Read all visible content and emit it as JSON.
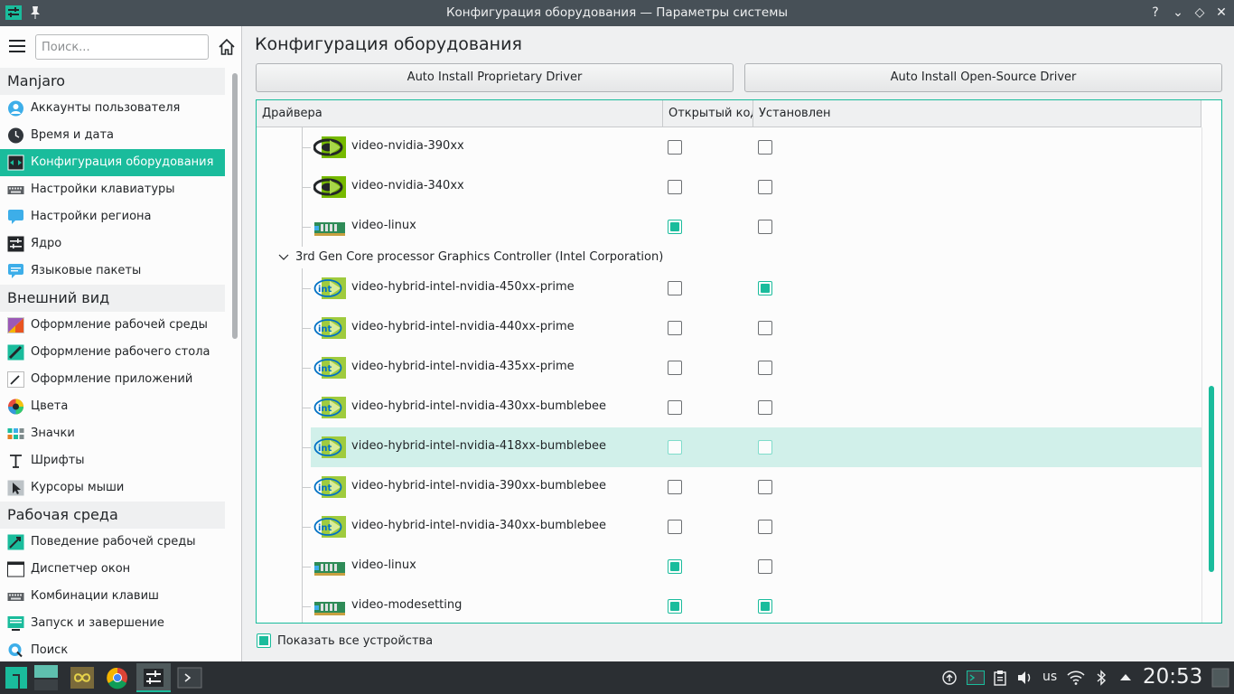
{
  "window": {
    "title": "Конфигурация оборудования — Параметры системы",
    "help_glyph": "?",
    "minimize_glyph": "⌄",
    "maximize_glyph": "◇",
    "close_glyph": "✕"
  },
  "sidebar": {
    "search_placeholder": "Поиск...",
    "categories": [
      {
        "label": "Manjaro",
        "items": [
          {
            "label": "Аккаунты пользователя",
            "icon": "user-icon"
          },
          {
            "label": "Время и дата",
            "icon": "clock-icon"
          },
          {
            "label": "Конфигурация оборудования",
            "icon": "hardware-icon",
            "selected": true
          },
          {
            "label": "Настройки клавиатуры",
            "icon": "keyboard-icon"
          },
          {
            "label": "Настройки региона",
            "icon": "region-icon"
          },
          {
            "label": "Ядро",
            "icon": "kernel-icon"
          },
          {
            "label": "Языковые пакеты",
            "icon": "language-icon"
          }
        ]
      },
      {
        "label": "Внешний вид",
        "items": [
          {
            "label": "Оформление рабочей среды",
            "icon": "workspace-theme-icon"
          },
          {
            "label": "Оформление рабочего стола",
            "icon": "desktop-theme-icon"
          },
          {
            "label": "Оформление приложений",
            "icon": "app-style-icon"
          },
          {
            "label": "Цвета",
            "icon": "colors-icon"
          },
          {
            "label": "Значки",
            "icon": "icons-icon"
          },
          {
            "label": "Шрифты",
            "icon": "fonts-icon"
          },
          {
            "label": "Курсоры мыши",
            "icon": "cursor-icon"
          }
        ]
      },
      {
        "label": "Рабочая среда",
        "items": [
          {
            "label": "Поведение рабочей среды",
            "icon": "workspace-behavior-icon"
          },
          {
            "label": "Диспетчер окон",
            "icon": "window-manager-icon"
          },
          {
            "label": "Комбинации клавиш",
            "icon": "shortcuts-icon"
          },
          {
            "label": "Запуск и завершение",
            "icon": "startup-icon"
          },
          {
            "label": "Поиск",
            "icon": "search-icon"
          }
        ]
      }
    ]
  },
  "main": {
    "title": "Конфигурация оборудования",
    "btn_proprietary": "Auto Install Proprietary Driver",
    "btn_opensource": "Auto Install Open-Source Driver",
    "columns": [
      "Драйвера",
      "Открытый код",
      "Установлен"
    ],
    "rows_top": [
      {
        "name": "video-nvidia-390xx",
        "icon": "nvidia-icon",
        "open": false,
        "installed": false
      },
      {
        "name": "video-nvidia-340xx",
        "icon": "nvidia-icon",
        "open": false,
        "installed": false
      },
      {
        "name": "video-linux",
        "icon": "video-card-icon",
        "open": true,
        "installed": false
      }
    ],
    "group_label": "3rd Gen Core processor Graphics Controller (Intel Corporation)",
    "rows_group": [
      {
        "name": "video-hybrid-intel-nvidia-450xx-prime",
        "icon": "intel-icon",
        "open": false,
        "installed": true
      },
      {
        "name": "video-hybrid-intel-nvidia-440xx-prime",
        "icon": "intel-icon",
        "open": false,
        "installed": false
      },
      {
        "name": "video-hybrid-intel-nvidia-435xx-prime",
        "icon": "intel-icon",
        "open": false,
        "installed": false
      },
      {
        "name": "video-hybrid-intel-nvidia-430xx-bumblebee",
        "icon": "intel-icon",
        "open": false,
        "installed": false
      },
      {
        "name": "video-hybrid-intel-nvidia-418xx-bumblebee",
        "icon": "intel-icon",
        "open": false,
        "installed": false,
        "highlight": true
      },
      {
        "name": "video-hybrid-intel-nvidia-390xx-bumblebee",
        "icon": "intel-icon",
        "open": false,
        "installed": false
      },
      {
        "name": "video-hybrid-intel-nvidia-340xx-bumblebee",
        "icon": "intel-icon",
        "open": false,
        "installed": false
      },
      {
        "name": "video-linux",
        "icon": "video-card-icon",
        "open": true,
        "installed": false
      },
      {
        "name": "video-modesetting",
        "icon": "video-card-icon",
        "open": true,
        "installed": true
      }
    ],
    "show_all_label": "Показать все устройства",
    "show_all_checked": true
  },
  "taskbar": {
    "keyboard_layout": "us",
    "clock": "20:53"
  },
  "colors": {
    "accent": "#1abc9c",
    "titlebar": "#475057",
    "taskbar": "#2b2f33"
  }
}
